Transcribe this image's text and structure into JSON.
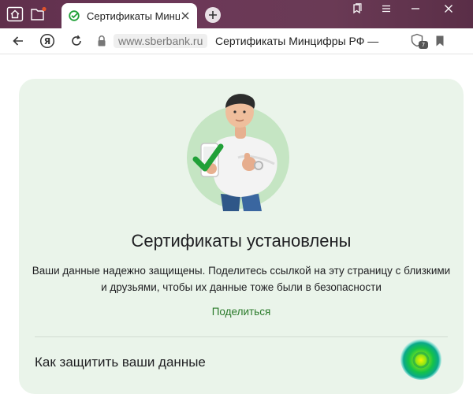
{
  "browser": {
    "tab": {
      "title": "Сертификаты Минцифр"
    },
    "address_bar": {
      "domain": "www.sberbank.ru",
      "page_title": "Сертификаты Минцифры РФ —",
      "badge_count": "7"
    }
  },
  "colors": {
    "card_background": "#eaf4ea",
    "link_green": "#2a7a2a",
    "check_green": "#21a038",
    "titlebar": "#6a3a55"
  },
  "card": {
    "title": "Сертификаты установлены",
    "description": "Ваши данные надежно защищены. Поделитесь ссылкой на эту страницу с близкими и друзьями, чтобы их данные тоже были в безопасности",
    "share_label": "Поделиться",
    "section_title": "Как защитить ваши данные"
  },
  "icons": {
    "home": "home-icon",
    "new_folder": "folder-icon",
    "favicon": "sber-logo-icon",
    "tab_close": "close-icon",
    "new_tab": "plus-icon",
    "bookmarks_panel": "bookmarks-panel-icon",
    "menu": "hamburger-icon",
    "minimize": "minimize-icon",
    "close_window": "close-icon",
    "back": "arrow-left-icon",
    "yandex": "yandex-icon",
    "reload": "reload-icon",
    "lock": "lock-icon",
    "protect": "protect-icon",
    "bookmark": "bookmark-icon"
  }
}
